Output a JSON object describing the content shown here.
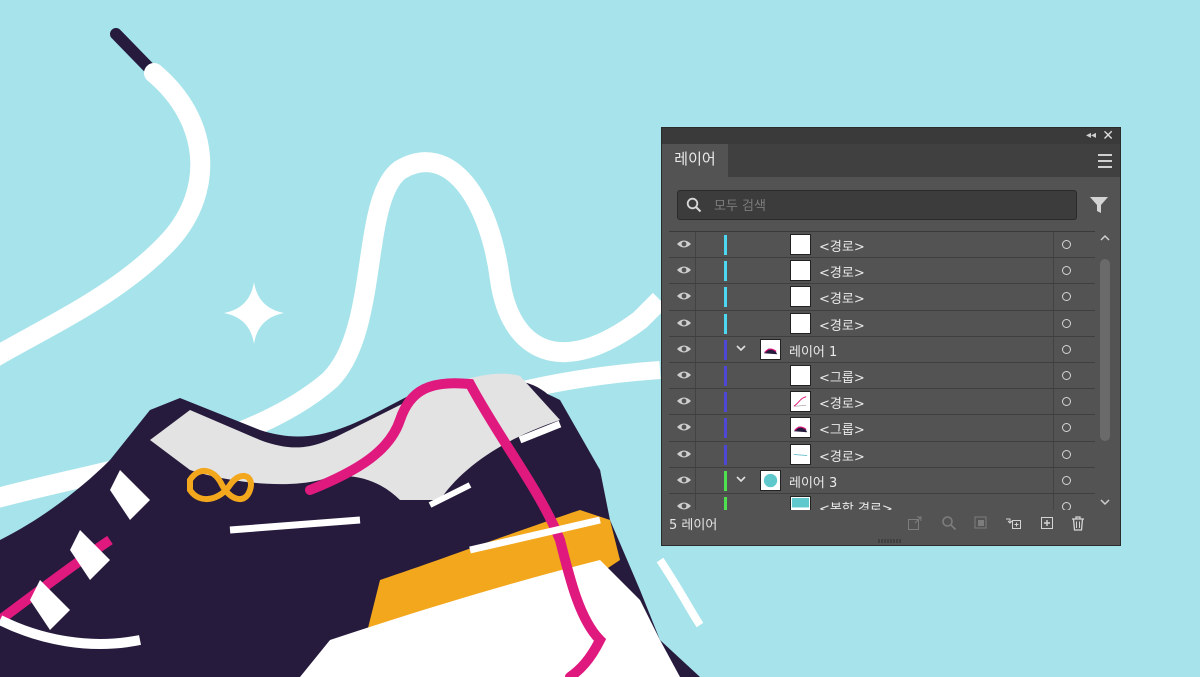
{
  "panel": {
    "tab_label": "레이어",
    "search_placeholder": "모두 검색",
    "layer_count": "5 레이어"
  },
  "layers": [
    {
      "name": "<경로>",
      "color": "#4dd7f0",
      "depth": 2,
      "expanded": null,
      "thumb": "blank"
    },
    {
      "name": "<경로>",
      "color": "#4dd7f0",
      "depth": 2,
      "expanded": null,
      "thumb": "blank"
    },
    {
      "name": "<경로>",
      "color": "#4dd7f0",
      "depth": 2,
      "expanded": null,
      "thumb": "blank"
    },
    {
      "name": "<경로>",
      "color": "#4dd7f0",
      "depth": 2,
      "expanded": null,
      "thumb": "blank"
    },
    {
      "name": "레이어 1",
      "color": "#4f47d6",
      "depth": 1,
      "expanded": true,
      "thumb": "shoe"
    },
    {
      "name": "<그룹>",
      "color": "#4f47d6",
      "depth": 2,
      "expanded": null,
      "thumb": "blank"
    },
    {
      "name": "<경로>",
      "color": "#4f47d6",
      "depth": 2,
      "expanded": null,
      "thumb": "pinkline"
    },
    {
      "name": "<그룹>",
      "color": "#4f47d6",
      "depth": 2,
      "expanded": null,
      "thumb": "shoe"
    },
    {
      "name": "<경로>",
      "color": "#4f47d6",
      "depth": 2,
      "expanded": null,
      "thumb": "line"
    },
    {
      "name": "레이어 3",
      "color": "#4fe04f",
      "depth": 1,
      "expanded": true,
      "thumb": "circle"
    },
    {
      "name": "<복합 경로>",
      "color": "#4fe04f",
      "depth": 2,
      "expanded": null,
      "thumb": "teal"
    }
  ],
  "colors": {
    "canvas_bg": "#a6e3ea",
    "shoe_dark": "#261b3d",
    "shoe_pink": "#e0197f",
    "shoe_orange": "#f2a71d",
    "shoe_gray": "#e3e3e3",
    "panel_bg": "#535353"
  }
}
